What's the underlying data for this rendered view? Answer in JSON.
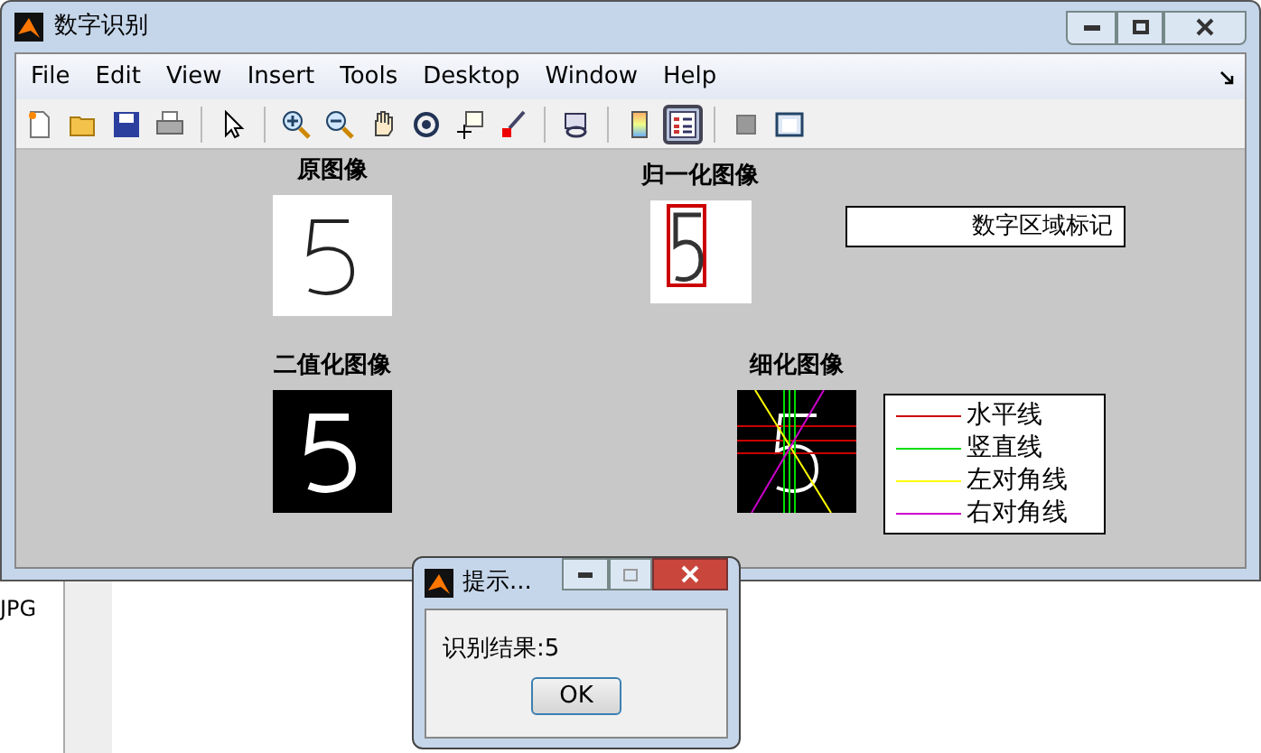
{
  "window": {
    "title": "数字识别"
  },
  "menu": [
    "File",
    "Edit",
    "View",
    "Insert",
    "Tools",
    "Desktop",
    "Window",
    "Help"
  ],
  "toolbar": [
    {
      "kind": "new",
      "pressed": false
    },
    {
      "kind": "open",
      "pressed": false
    },
    {
      "kind": "save",
      "pressed": false
    },
    {
      "kind": "print",
      "pressed": false
    },
    {
      "kind": "sep"
    },
    {
      "kind": "pointer",
      "pressed": false
    },
    {
      "kind": "sep"
    },
    {
      "kind": "zoomin",
      "pressed": false
    },
    {
      "kind": "zoomout",
      "pressed": false
    },
    {
      "kind": "pan",
      "pressed": false
    },
    {
      "kind": "rotate",
      "pressed": false
    },
    {
      "kind": "datacursor",
      "pressed": false
    },
    {
      "kind": "brush",
      "pressed": false
    },
    {
      "kind": "sep"
    },
    {
      "kind": "link",
      "pressed": false
    },
    {
      "kind": "sep"
    },
    {
      "kind": "colorbar",
      "pressed": false
    },
    {
      "kind": "legend",
      "pressed": true
    },
    {
      "kind": "sep"
    },
    {
      "kind": "hideplot",
      "pressed": false
    },
    {
      "kind": "showplot",
      "pressed": false
    }
  ],
  "axes": [
    {
      "kind": "original",
      "title": "原图像"
    },
    {
      "kind": "normalized",
      "title": "归一化图像",
      "annotation": "数字区域标记"
    },
    {
      "kind": "binary",
      "title": "二值化图像"
    },
    {
      "kind": "thinned",
      "title": "细化图像",
      "legend": [
        {
          "label": "水平线",
          "color": "#cc0000"
        },
        {
          "label": "竖直线",
          "color": "#00dd00"
        },
        {
          "label": "左对角线",
          "color": "#ffff00"
        },
        {
          "label": "右对角线",
          "color": "#cc00cc"
        }
      ]
    }
  ],
  "background": {
    "file_label": "JPG"
  },
  "dialog": {
    "title": "提示...",
    "message": "识别结果:5",
    "button": "OK"
  }
}
